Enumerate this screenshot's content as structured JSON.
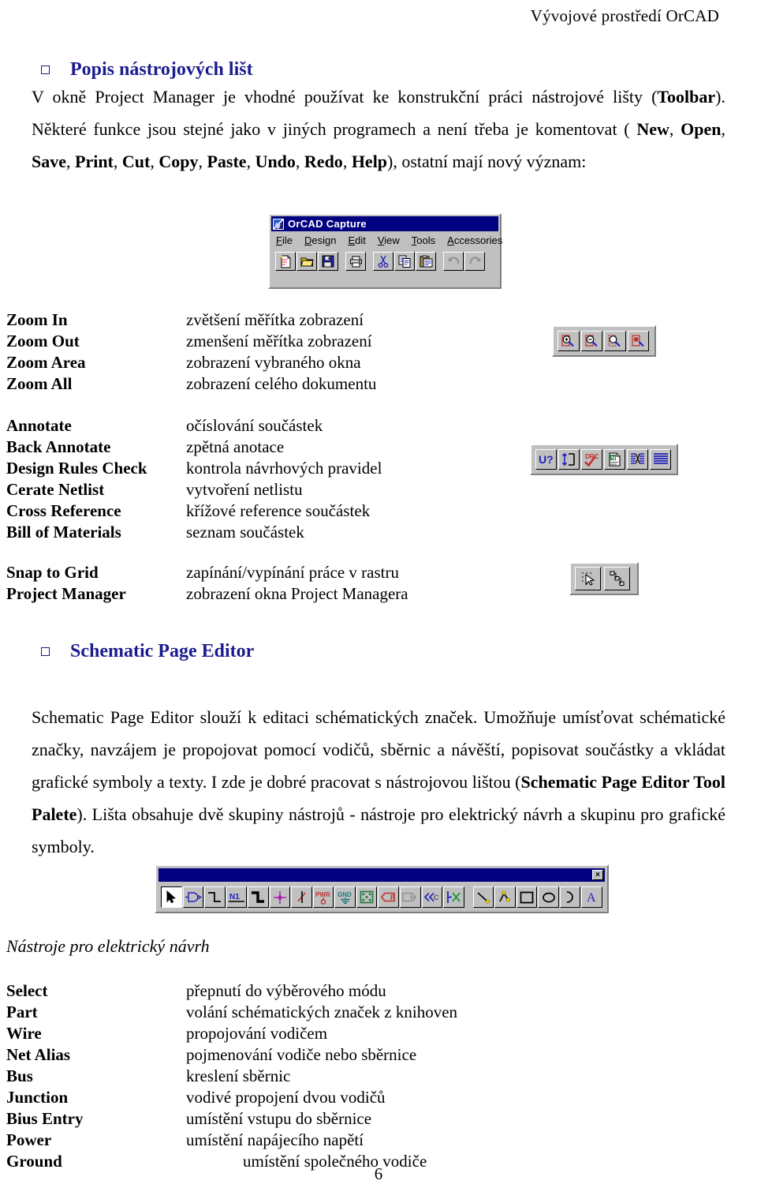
{
  "running_header": "Vývojové prostředí OrCAD",
  "headings": {
    "toolbars": "Popis nástrojových lišt",
    "schematic_page_editor": "Schematic Page Editor"
  },
  "paragraphs": {
    "intro_1": "V okně Project Manager je vhodné používat ke konstrukční práci nástrojové lišty (",
    "intro_1_b1": "Toolbar",
    "intro_2": "). Některé funkce jsou stejné jako v jiných programech a není třeba je komentovat ( ",
    "intro_b_new": "New",
    "intro_b_open": "Open",
    "intro_b_save": "Save",
    "intro_b_print": "Print",
    "intro_b_cut": "Cut",
    "intro_b_copy": "Copy",
    "intro_b_paste": "Paste",
    "intro_b_undo": "Undo",
    "intro_b_redo": "Redo",
    "intro_b_help": "Help",
    "intro_3": "), ostatní mají nový význam:",
    "spe_1": "Schematic Page Editor slouží k editaci schématických značek. Umožňuje umísťovat schématické značky, navzájem je propojovat pomocí vodičů, sběrnic a návěští, popisovat součástky a vkládat grafické symboly a texty. I zde je dobré pracovat s nástrojovou lištou (",
    "spe_b": "Schematic Page Editor Tool Palete",
    "spe_2": "). Lišta obsahuje dvě skupiny nástrojů - nástroje pro elektrický návrh a skupinu pro grafické symboly."
  },
  "capture_window": {
    "title": "OrCAD Capture",
    "icon": "orcad-capture-icon",
    "menu": [
      {
        "pre": "",
        "key": "F",
        "post": "ile"
      },
      {
        "pre": "",
        "key": "D",
        "post": "esign"
      },
      {
        "pre": "",
        "key": "E",
        "post": "dit"
      },
      {
        "pre": "",
        "key": "V",
        "post": "iew"
      },
      {
        "pre": "",
        "key": "T",
        "post": "ools"
      },
      {
        "pre": "",
        "key": "A",
        "post": "ccessories"
      }
    ],
    "toolbar_buttons": [
      "new-icon",
      "open-icon",
      "save-icon",
      "print-icon",
      "cut-icon",
      "copy-icon",
      "paste-icon",
      "undo-icon",
      "redo-icon"
    ]
  },
  "zoom_section": {
    "toolbar_buttons": [
      "zoom-in-icon",
      "zoom-out-icon",
      "zoom-area-icon",
      "zoom-all-icon"
    ],
    "rows": [
      {
        "term": "Zoom In",
        "desc": "zvětšení měřítka zobrazení"
      },
      {
        "term": "Zoom Out",
        "desc": "zmenšení měřítka zobrazení"
      },
      {
        "term": "Zoom Area",
        "desc": "zobrazení vybraného okna"
      },
      {
        "term": "Zoom All",
        "desc": "zobrazení celého dokumentu"
      }
    ]
  },
  "annotate_section": {
    "toolbar_buttons": [
      "annotate-icon",
      "back-annotate-icon",
      "design-rules-check-icon",
      "create-netlist-icon",
      "cross-reference-icon",
      "bill-of-materials-icon"
    ],
    "rows": [
      {
        "term": "Annotate",
        "desc": "očíslování součástek"
      },
      {
        "term": "Back Annotate",
        "desc": "zpětná anotace"
      },
      {
        "term": "Design Rules Check",
        "desc": "kontrola návrhových pravidel"
      },
      {
        "term": "Cerate Netlist",
        "desc": "vytvoření netlistu"
      },
      {
        "term": "Cross Reference",
        "desc": "křížové reference součástek"
      },
      {
        "term": "Bill of Materials",
        "desc": "seznam součástek"
      }
    ]
  },
  "grid_section": {
    "toolbar_buttons": [
      "snap-to-grid-icon",
      "project-manager-icon"
    ],
    "rows": [
      {
        "term": "Snap to Grid",
        "desc": "zapínání/vypínání práce v rastru"
      },
      {
        "term": "Project Manager",
        "desc": "zobrazení okna Project Managera"
      }
    ]
  },
  "tool_palette": {
    "close_label": "×",
    "electrical_tools": [
      "select-tool-icon",
      "part-tool-icon",
      "wire-tool-icon",
      "net-alias-tool-icon",
      "bus-tool-icon",
      "junction-tool-icon",
      "bus-entry-tool-icon",
      "power-tool-icon",
      "ground-tool-icon",
      "hierarchical-block-tool-icon",
      "port-tool-icon",
      "pin-tool-icon",
      "off-page-connector-tool-icon",
      "no-connect-tool-icon"
    ],
    "graphic_tools": [
      "line-tool-icon",
      "polyline-tool-icon",
      "rectangle-tool-icon",
      "ellipse-tool-icon",
      "arc-tool-icon",
      "text-tool-icon"
    ],
    "labels": {
      "net_alias": "N1",
      "power": "PWR",
      "ground": "GND",
      "port": "P",
      "pin": "H",
      "offpage": "C",
      "text": "A"
    }
  },
  "electrical_section": {
    "subtitle": "Nástroje pro elektrický návrh",
    "rows": [
      {
        "term": "Select",
        "desc": "přepnutí do výběrového módu",
        "indent": false
      },
      {
        "term": "Part",
        "desc": "volání schématických značek z knihoven",
        "indent": false
      },
      {
        "term": "Wire",
        "desc": "propojování vodičem",
        "indent": false
      },
      {
        "term": "Net Alias",
        "desc": "pojmenování vodiče nebo sběrnice",
        "indent": false
      },
      {
        "term": "Bus",
        "desc": "kreslení sběrnic",
        "indent": false
      },
      {
        "term": "Junction",
        "desc": "vodivé propojení dvou vodičů",
        "indent": false
      },
      {
        "term": "Bius Entry",
        "desc": "umístění vstupu do sběrnice",
        "indent": false
      },
      {
        "term": "Power",
        "desc": "umístění napájecího napětí",
        "indent": false
      },
      {
        "term": "Ground",
        "desc": "umístění společného vodiče",
        "indent": true
      }
    ]
  },
  "page_number": "6",
  "colors": {
    "heading": "#1b1b8f",
    "titlebar": "#000080",
    "chrome": "#c0c0c0",
    "text": "#000000"
  }
}
